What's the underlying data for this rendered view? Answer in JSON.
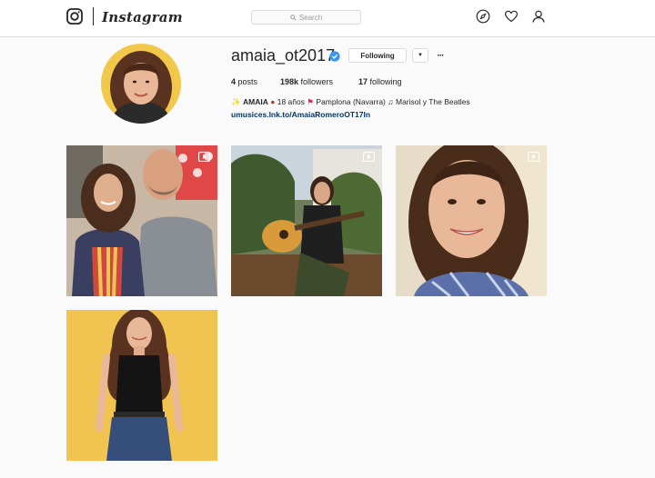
{
  "header": {
    "app_name": "Instagram",
    "search_placeholder": "Search",
    "icons": [
      "instagram-glyph-icon",
      "compass-icon",
      "heart-icon",
      "user-icon"
    ]
  },
  "profile": {
    "username": "amaia_ot2017",
    "verified": true,
    "following_label": "Following",
    "dropdown_glyph": "▼",
    "more_glyph": "···",
    "stats": {
      "posts_count": "4",
      "posts_label": "posts",
      "followers_count": "198k",
      "followers_label": "followers",
      "following_count": "17",
      "following_label": "following"
    },
    "bio": {
      "name": "AMAIA",
      "age_text": "18 años",
      "location_text": "Pamplona (Navarra)",
      "music_text": "Marisol y The Beatles",
      "link": "umusices.lnk.to/AmaiaRomeroOT17In"
    }
  },
  "posts": [
    {
      "id": 1,
      "type": "video",
      "description": "photo with a bald man"
    },
    {
      "id": 2,
      "type": "video",
      "description": "playing guitar outdoors"
    },
    {
      "id": 3,
      "type": "video",
      "description": "smiling close-up selfie"
    },
    {
      "id": 4,
      "type": "photo",
      "description": "standing against yellow wall"
    }
  ],
  "colors": {
    "background": "#fafafa",
    "border": "#dbdbdb",
    "text": "#262626",
    "link": "#003569",
    "verified_blue": "#3897f0"
  }
}
